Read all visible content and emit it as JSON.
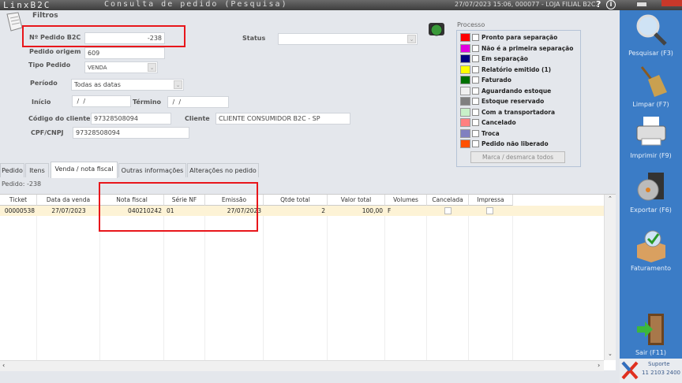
{
  "titlebar": {
    "logo": "LinxB2C",
    "title": "Consulta de pedido (Pesquisa)",
    "info": "27/07/2023 15:06, 000077 - LOJA FILIAL B2C.",
    "help": "?",
    "about": "i"
  },
  "filters": {
    "heading": "Filtros",
    "pedido_b2c": {
      "label": "Nº Pedido B2C",
      "value": "-238"
    },
    "pedido_origem": {
      "label": "Pedido origem",
      "value": "609"
    },
    "tipo_pedido": {
      "label": "Tipo Pedido",
      "value": "VENDA"
    },
    "periodo": {
      "label": "Período",
      "value": "Todas as datas"
    },
    "inicio": {
      "label": "Início",
      "value": " /  /"
    },
    "termino": {
      "label": "Término",
      "value": " /  /"
    },
    "codigo_cliente": {
      "label": "Código do cliente",
      "value": "97328508094"
    },
    "cliente": {
      "label": "Cliente",
      "value": "CLIENTE CONSUMIDOR B2C - SP"
    },
    "cpf": {
      "label": "CPF/CNPJ",
      "value": "97328508094"
    },
    "status": {
      "label": "Status",
      "value": ""
    }
  },
  "processo": {
    "label": "Processo",
    "button": "Marca / desmarca todos",
    "items": [
      {
        "label": "Pronto para separação",
        "color": "#ff0000"
      },
      {
        "label": "Não é a primeira separação",
        "color": "#e000e0"
      },
      {
        "label": "Em separação",
        "color": "#000080"
      },
      {
        "label": "Relatório emitido (1)",
        "color": "#ffff00"
      },
      {
        "label": "Faturado",
        "color": "#007000"
      },
      {
        "label": "Aguardando estoque",
        "color": "#f0f0f0"
      },
      {
        "label": "Estoque reservado",
        "color": "#808080"
      },
      {
        "label": "Com a transportadora",
        "color": "#c8f0c8"
      },
      {
        "label": "Cancelado",
        "color": "#ff8080"
      },
      {
        "label": "Troca",
        "color": "#8080c0"
      },
      {
        "label": "Pedido não liberado",
        "color": "#ff5000"
      }
    ]
  },
  "tabs": [
    {
      "label": "Pedido"
    },
    {
      "label": "Itens"
    },
    {
      "label": "Venda / nota fiscal",
      "active": true
    },
    {
      "label": "Outras informações"
    },
    {
      "label": "Alterações no pedido"
    }
  ],
  "pedido_info": "Pedido: -238",
  "table": {
    "columns": [
      "Ticket",
      "Data da venda",
      "Nota fiscal",
      "Série NF",
      "Emissão",
      "Qtde total",
      "Valor total",
      "Volumes",
      "Cancelada",
      "Impressa"
    ],
    "rows": [
      {
        "ticket": "00000538",
        "data": "27/07/2023",
        "nota": "040210242",
        "serie": "01",
        "emissao": "27/07/2023",
        "qtde": "2",
        "valor": "100,00",
        "volumes": "F",
        "cancelada": false,
        "impressa": false
      }
    ]
  },
  "sidebar": {
    "items": [
      {
        "label": "Pesquisar (F3)",
        "icon": "magnifier-icon"
      },
      {
        "label": "Limpar (F7)",
        "icon": "broom-icon"
      },
      {
        "label": "Imprimir (F9)",
        "icon": "printer-icon"
      },
      {
        "label": "Exportar (F6)",
        "icon": "cd-export-icon"
      },
      {
        "label": "Faturamento",
        "icon": "box-check-icon"
      },
      {
        "label": "Sair (F11)",
        "icon": "door-exit-icon"
      }
    ]
  },
  "support": {
    "label": "Suporte",
    "phone": "11 2103 2400"
  },
  "colors": {
    "sidebar": "#3b7cc6",
    "highlight_box": "#e8161b",
    "selected_row": "#fdf3d6"
  }
}
